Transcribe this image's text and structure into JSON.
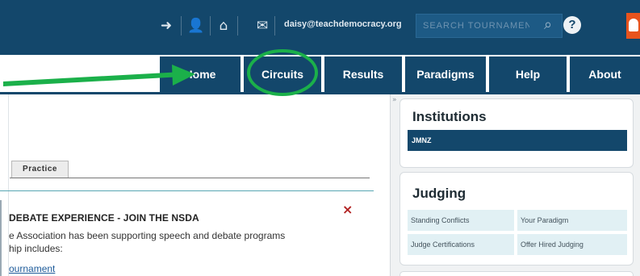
{
  "header": {
    "email": "daisy@teachdemocracy.org",
    "search_placeholder": "SEARCH TOURNAMENTS",
    "help_label": "?",
    "icons": [
      "logout-icon",
      "user-icon",
      "home-icon",
      "envelope-icon",
      "search-icon",
      "help-icon",
      "notification-icon"
    ]
  },
  "nav": {
    "home": "Home",
    "circuits": "Circuits",
    "results": "Results",
    "paradigms": "Paradigms",
    "help": "Help",
    "about": "About"
  },
  "main": {
    "tab_label": "Practice",
    "notice_title": "DEBATE EXPERIENCE - JOIN THE NSDA",
    "notice_line1": "e Association has been supporting speech and debate programs",
    "notice_line2": "hip includes:",
    "notice_link": "ournament",
    "close_symbol": "×"
  },
  "sidebar": {
    "collapse_symbol": "»",
    "institutions": {
      "title": "Institutions",
      "items": [
        "JMNZ"
      ]
    },
    "judging": {
      "title": "Judging",
      "items": [
        "Standing Conflicts",
        "Your Paradigm",
        "Judge Certifications",
        "Offer Hired Judging"
      ]
    }
  },
  "colors": {
    "primary": "#13476b",
    "annotation": "#1bb04a",
    "close": "#b22222",
    "judging_cell": "#e1f0f4"
  }
}
